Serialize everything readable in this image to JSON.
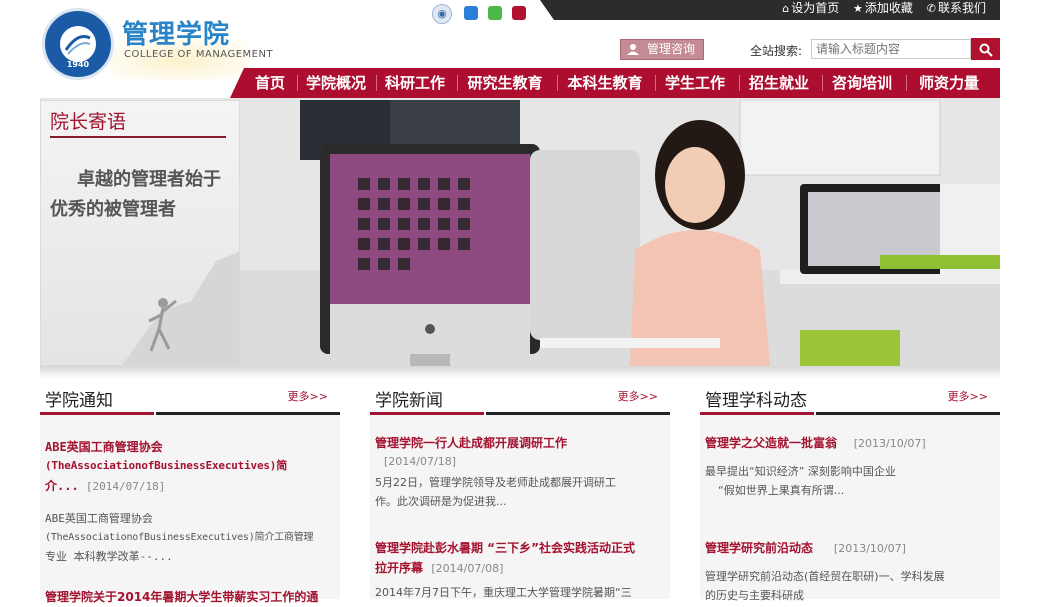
{
  "header": {
    "logo_title": "管理学院",
    "logo_subtitle": "COLLEGE OF MANAGEMENT",
    "logo_year": "1940",
    "top_links": [
      "设为首页",
      "添加收藏",
      "联系我们"
    ],
    "consult_button": "管理咨询",
    "search_label": "全站搜索:",
    "search_placeholder": "请输入标题内容",
    "color_dots": [
      "#2a7fd8",
      "#4cb848",
      "#b0122e"
    ],
    "accent_color": "#ad0e30"
  },
  "nav": [
    "首页",
    "学院概况",
    "科研工作",
    "研究生教育",
    "本科生教育",
    "学生工作",
    "招生就业",
    "咨询培训",
    "师资力量"
  ],
  "banner": {
    "title": "院长寄语",
    "quote_line1": "卓越的管理者始于",
    "quote_line2": "优秀的被管理者"
  },
  "columns": [
    {
      "title": "学院通知",
      "more": "更多>>",
      "items": [
        {
          "title_line1": "ABE英国工商管理协会",
          "title_line2": "(TheAssociationofBusinessExecutives)简",
          "title_line3": "介...",
          "date": "[2014/07/18]",
          "desc_line1": "ABE英国工商管理协会",
          "desc_line2": "(TheAssociationofBusinessExecutives)简介工商管理",
          "desc_line3": "专业 本科教学改革--..."
        },
        {
          "title_line1": "管理学院关于2014年暑期大学生带薪实习工作的通"
        }
      ]
    },
    {
      "title": "学院新闻",
      "more": "更多>>",
      "items": [
        {
          "title_line1": "管理学院一行人赴成都开展调研工作",
          "date": "[2014/07/18]",
          "desc_line1": "5月22日，管理学院领导及老师赴成都展开调研工",
          "desc_line2": "作。此次调研是为促进我..."
        },
        {
          "title_line1": "管理学院赴彭水暑期 “三下乡”社会实践活动正式",
          "title_line2": "拉开序幕",
          "date": "[2014/07/08]",
          "desc_line1": "2014年7月7日下午，重庆理工大学管理学院暑期“三"
        }
      ]
    },
    {
      "title": "管理学科动态",
      "more": "更多>>",
      "items": [
        {
          "title_line1": "管理学之父造就一批富翁",
          "date": "[2013/10/07]",
          "desc_line1": "最早提出“知识经济”  深刻影响中国企业",
          "desc_line2": "“假如世界上果真有所谓..."
        },
        {
          "title_line1": "管理学研究前沿动态",
          "date": "[2013/10/07]",
          "desc_line1": "管理学研究前沿动态(首经贸在职研)一、学科发展",
          "desc_line2": "的历史与主要科研成"
        }
      ]
    }
  ]
}
